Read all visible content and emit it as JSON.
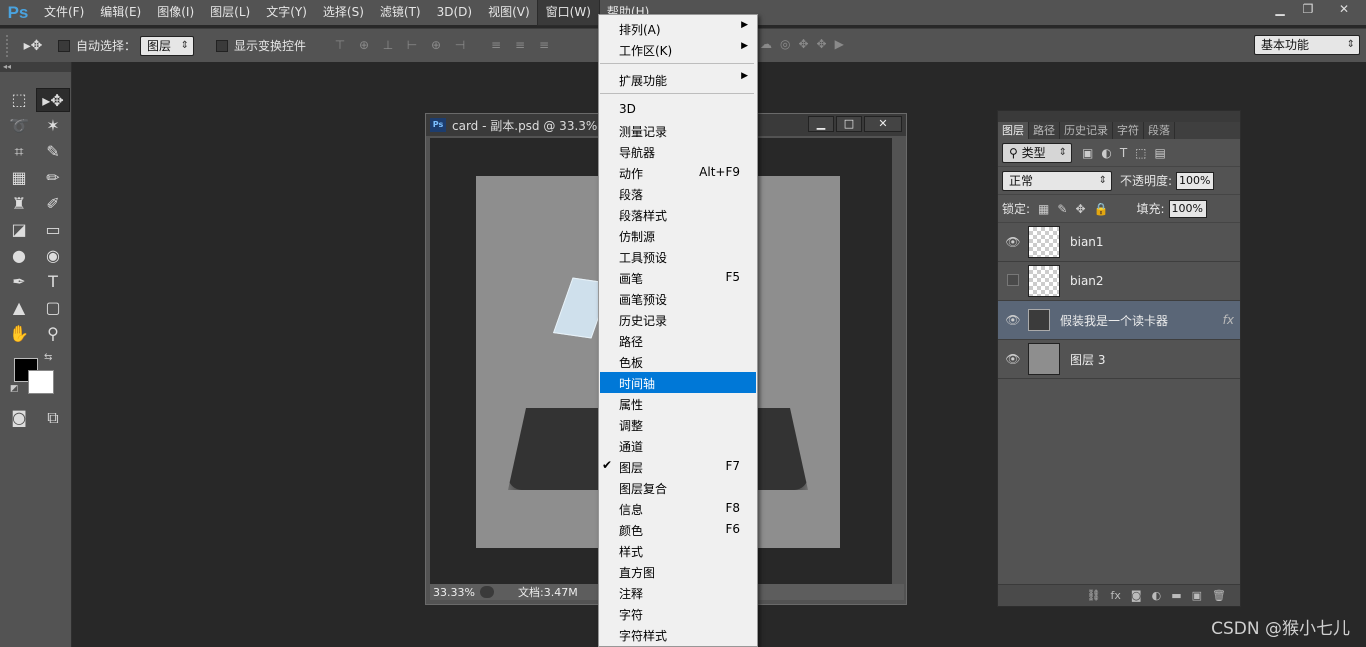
{
  "app": {
    "logo": "Ps",
    "menu": [
      "文件(F)",
      "编辑(E)",
      "图像(I)",
      "图层(L)",
      "文字(Y)",
      "选择(S)",
      "滤镜(T)",
      "3D(D)",
      "视图(V)",
      "窗口(W)",
      "帮助(H)"
    ],
    "active_menu": "窗口(W)"
  },
  "options": {
    "auto_select_label": "自动选择：",
    "auto_select_value": "图层",
    "show_transform_label": "显示变换控件",
    "workspace": "基本功能"
  },
  "document": {
    "title": "card - 副本.psd @ 33.3% (f",
    "zoom": "33.33%",
    "doc_info": "文档:3.47M"
  },
  "layers_panel": {
    "tabs": [
      "图层",
      "路径",
      "历史记录",
      "字符",
      "段落"
    ],
    "filter": "类型",
    "blend_mode": "正常",
    "opacity_label": "不透明度:",
    "opacity": "100%",
    "lock_label": "锁定:",
    "fill_label": "填充:",
    "fill": "100%",
    "layers": [
      {
        "name": "bian1",
        "visible": true
      },
      {
        "name": "bian2",
        "visible": false
      },
      {
        "name": "假装我是一个读卡器",
        "visible": true,
        "fx": "fx",
        "selected": true
      },
      {
        "name": "图层 3",
        "visible": true
      }
    ]
  },
  "window_menu": {
    "items": [
      {
        "label": "排列(A)",
        "submenu": true
      },
      {
        "label": "工作区(K)",
        "submenu": true
      },
      {
        "label": "扩展功能",
        "submenu": true
      },
      {
        "label": "3D"
      },
      {
        "label": "测量记录"
      },
      {
        "label": "导航器"
      },
      {
        "label": "动作",
        "shortcut": "Alt+F9"
      },
      {
        "label": "段落"
      },
      {
        "label": "段落样式"
      },
      {
        "label": "仿制源"
      },
      {
        "label": "工具预设"
      },
      {
        "label": "画笔",
        "shortcut": "F5"
      },
      {
        "label": "画笔预设"
      },
      {
        "label": "历史记录"
      },
      {
        "label": "路径"
      },
      {
        "label": "色板"
      },
      {
        "label": "时间轴",
        "highlighted": true
      },
      {
        "label": "属性"
      },
      {
        "label": "调整"
      },
      {
        "label": "通道"
      },
      {
        "label": "图层",
        "shortcut": "F7",
        "checked": true
      },
      {
        "label": "图层复合"
      },
      {
        "label": "信息",
        "shortcut": "F8"
      },
      {
        "label": "颜色",
        "shortcut": "F6"
      },
      {
        "label": "样式"
      },
      {
        "label": "直方图"
      },
      {
        "label": "注释"
      },
      {
        "label": "字符"
      },
      {
        "label": "字符样式"
      }
    ]
  },
  "watermark": "CSDN @猴小七儿",
  "colors": {
    "highlight": "#0078d7",
    "panel": "#535353",
    "background": "#282828"
  }
}
